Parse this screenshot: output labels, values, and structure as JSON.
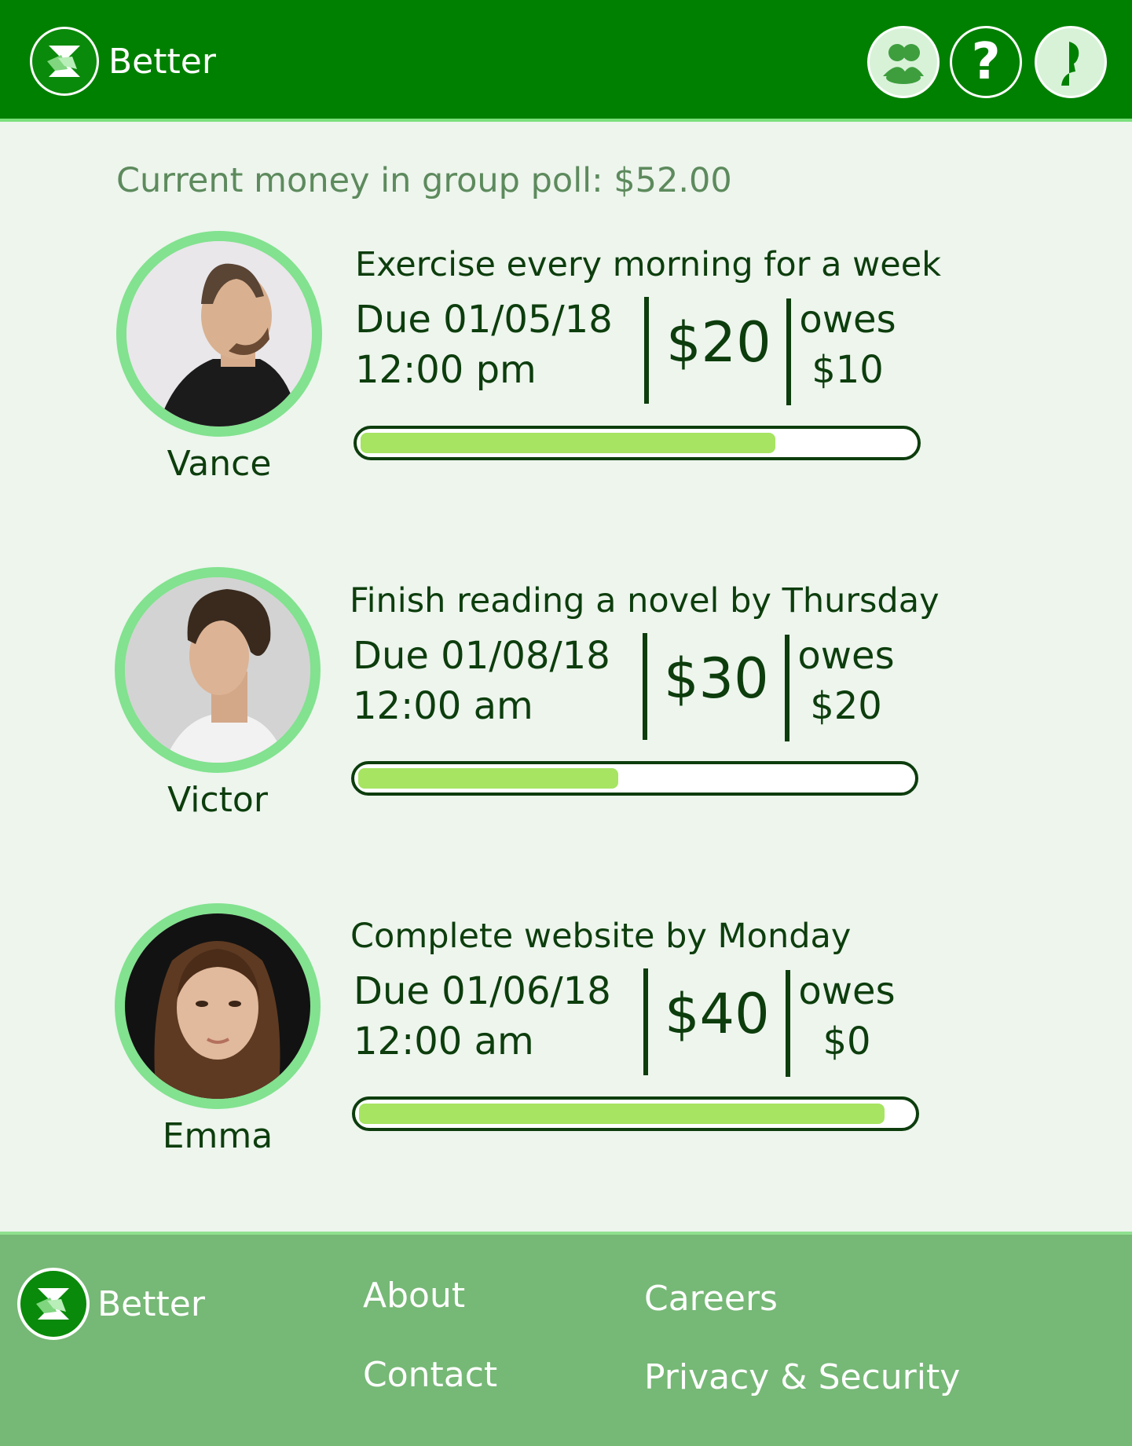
{
  "brand": {
    "name": "Better"
  },
  "header": {
    "icons": [
      "group-icon",
      "help-icon",
      "profile-icon"
    ],
    "help_glyph": "?"
  },
  "pool": {
    "text": "Current money in group poll: $52.00"
  },
  "bets": [
    {
      "name": "Vance",
      "goal": "Exercise every morning for a week",
      "due_date": "Due 01/05/18",
      "due_time": "12:00 pm",
      "amount": "$20",
      "owes_label": "owes",
      "owes_amount": "$10",
      "progress": 0.75
    },
    {
      "name": "Victor",
      "goal": "Finish reading a novel by Thursday",
      "due_date": "Due 01/08/18",
      "due_time": "12:00 am",
      "amount": "$30",
      "owes_label": "owes",
      "owes_amount": "$20",
      "progress": 0.47
    },
    {
      "name": "Emma",
      "goal": "Complete website by Monday",
      "due_date": "Due 01/06/18",
      "due_time": "12:00 am",
      "amount": "$40",
      "owes_label": "owes",
      "owes_amount": "$0",
      "progress": 0.95
    }
  ],
  "footer": {
    "brand": "Better",
    "links": {
      "about": "About",
      "careers": "Careers",
      "contact": "Contact",
      "privacy": "Privacy & Security"
    }
  },
  "colors": {
    "header_bg": "#008000",
    "page_bg": "#edf5ed",
    "accent_ring": "#82e28f",
    "progress_fill": "#a6e462",
    "footer_bg": "#76b876",
    "text_dark": "#0d3d0d"
  }
}
